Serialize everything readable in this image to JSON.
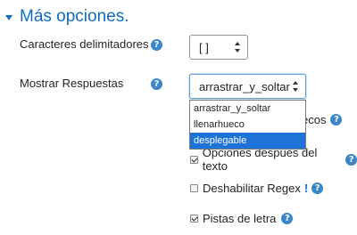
{
  "section": {
    "title": "Más opciones."
  },
  "fields": {
    "delimiters": {
      "label": "Caracteres delimitadores",
      "value": "[ ]"
    },
    "show_answers": {
      "label": "Mostrar Respuestas",
      "value": "arrastrar_y_soltar",
      "options": [
        "arrastrar_y_soltar",
        "llenarhueco",
        "desplegable"
      ],
      "highlighted": "desplegable"
    }
  },
  "checkboxes": {
    "partial_behind": {
      "label_visible": "ecos",
      "checked": false
    },
    "options_after_text": {
      "label": "Opciones después del texto",
      "checked": true
    },
    "disable_regex": {
      "label": "Deshabilitar Regex",
      "warning": "!",
      "checked": false
    },
    "letter_hints": {
      "label": "Pistas de letra",
      "checked": true
    }
  },
  "icons": {
    "help": "?"
  },
  "colors": {
    "accent": "#0f6cbf",
    "help_icon": "#3a86c8",
    "selected_option": "#1e73d9"
  }
}
